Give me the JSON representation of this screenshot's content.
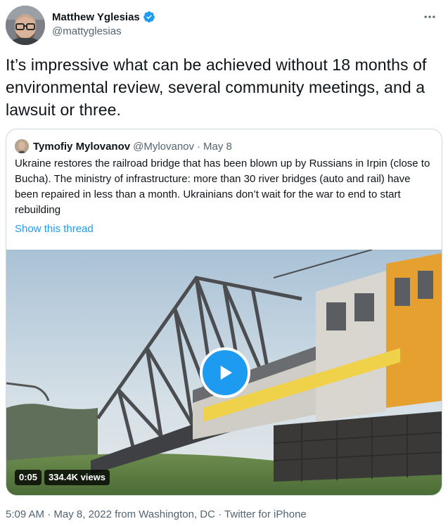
{
  "author": {
    "display_name": "Matthew Yglesias",
    "handle": "@mattyglesias",
    "verified": true,
    "avatar_icon": "profile-photo"
  },
  "tweet": {
    "text": "It’s impressive what can be achieved without 18 months of environmental review, several community meetings, and a lawsuit or three."
  },
  "quoted": {
    "display_name": "Tymofiy Mylovanov",
    "handle": "@Mylovanov",
    "separator": "·",
    "date": "May 8",
    "text": "Ukraine restores the railroad bridge that has been blown up by Russians in Irpin (close to Bucha). The ministry of infrastructure: more than 30 river bridges (auto and rail) have been repaired in less than a month. Ukrainians don’t wait for the war to end to start rebuilding",
    "show_thread": "Show this thread",
    "video": {
      "duration": "0:05",
      "views": "334.4K views",
      "play_icon": "play-icon"
    }
  },
  "meta": {
    "time": "5:09 AM",
    "sep1": "·",
    "date": "May 8, 2022",
    "location": "from Washington, DC",
    "sep2": "·",
    "client": "Twitter for iPhone"
  },
  "colors": {
    "accent": "#1d9bf0",
    "text": "#0f1419",
    "secondary": "#536471",
    "border": "#cfd9de"
  }
}
